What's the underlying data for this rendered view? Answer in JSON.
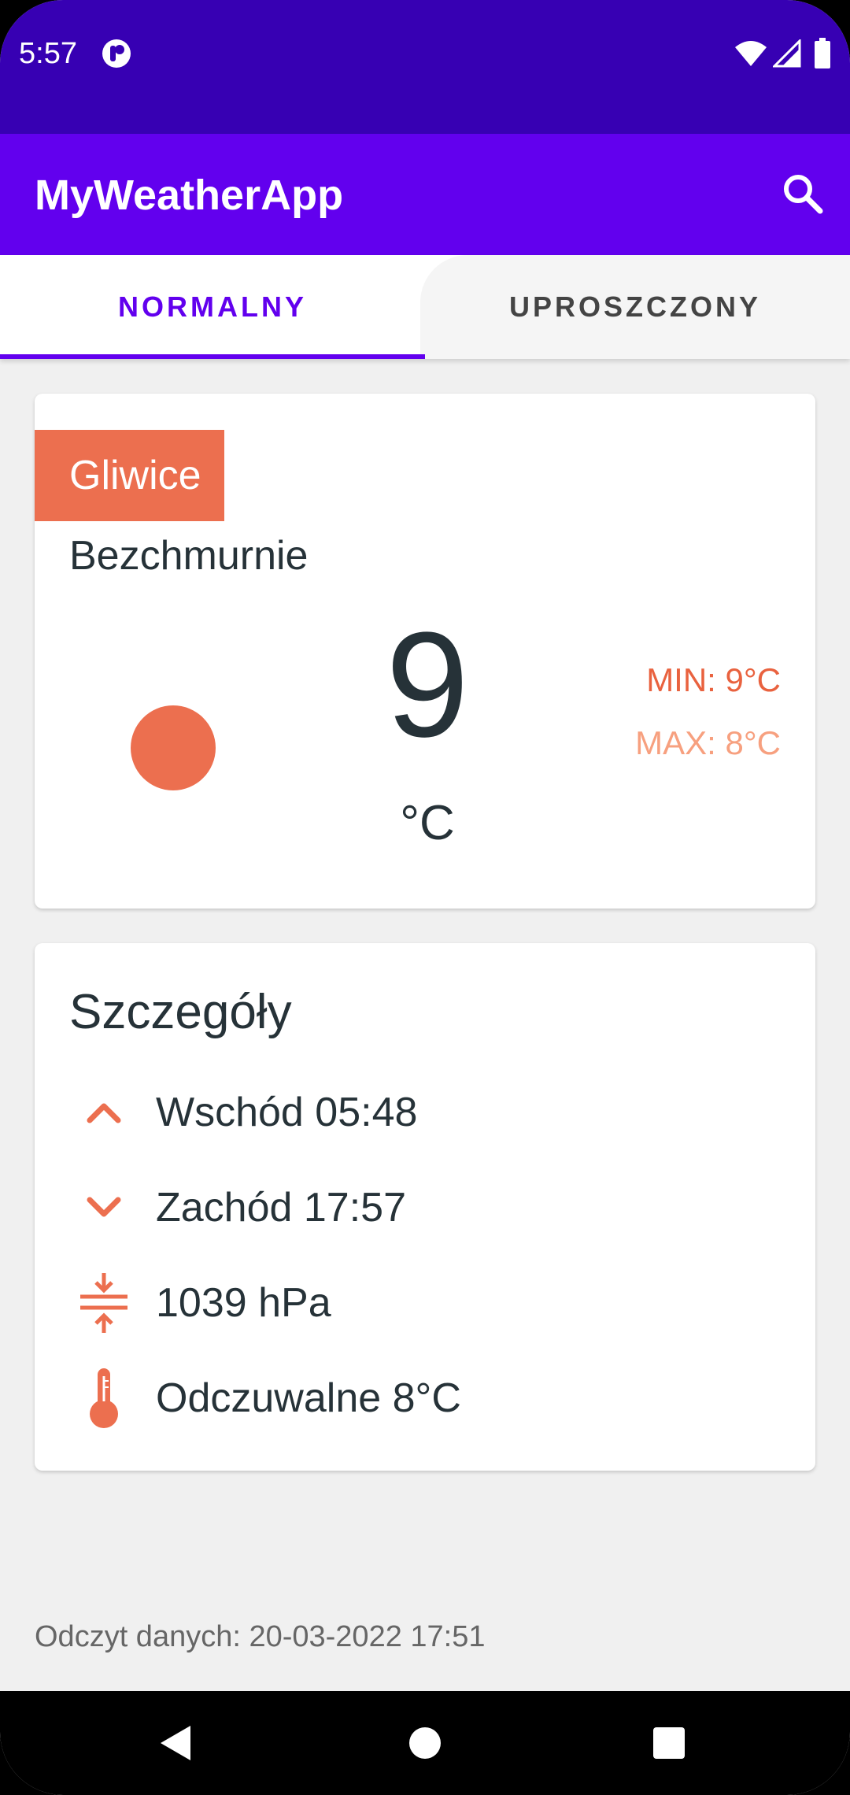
{
  "status_bar": {
    "time": "5:57",
    "icons": [
      "app-notification-icon",
      "wifi-icon",
      "signal-icon",
      "battery-icon"
    ]
  },
  "app_bar": {
    "title": "MyWeatherApp",
    "search_icon": "search-icon"
  },
  "tabs": [
    {
      "label": "NORMALNY",
      "selected": true
    },
    {
      "label": "UPROSZCZONY",
      "selected": false
    }
  ],
  "weather": {
    "city": "Gliwice",
    "condition": "Bezchmurnie",
    "temperature": "9",
    "unit": "°C",
    "min": "MIN: 9°C",
    "max": "MAX: 8°C"
  },
  "details": {
    "title": "Szczegóły",
    "items": [
      {
        "icon": "chevron-up-icon",
        "text": "Wschód 05:48"
      },
      {
        "icon": "chevron-down-icon",
        "text": "Zachód 17:57"
      },
      {
        "icon": "pressure-icon",
        "text": "1039 hPa"
      },
      {
        "icon": "thermometer-icon",
        "text": "Odczuwalne 8°C"
      }
    ]
  },
  "footer": {
    "reading": "Odczyt danych: 20-03-2022 17:51"
  },
  "colors": {
    "status_bar": "#3700b3",
    "app_bar": "#6200ee",
    "accent": "#ec6f4f",
    "max_temp": "#f7a07f",
    "text_dark": "#263238"
  }
}
